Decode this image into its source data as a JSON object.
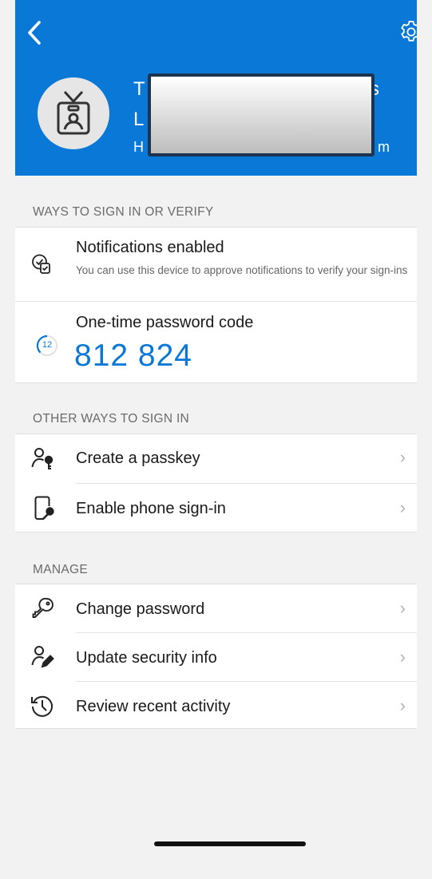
{
  "account": {
    "line1_start": "T",
    "line1_end": "s",
    "line2_start": "L",
    "line3_start": "H",
    "line3_end": "m"
  },
  "sections": {
    "ways": "WAYS TO SIGN IN OR VERIFY",
    "other": "OTHER WAYS TO SIGN IN",
    "manage": "MANAGE"
  },
  "notifications": {
    "title": "Notifications enabled",
    "subtitle": "You can use this device to approve notifications to verify your sign-ins"
  },
  "otp": {
    "title": "One-time password code",
    "code": "812 824",
    "seconds_remaining": "12"
  },
  "other_items": [
    {
      "label": "Create a passkey"
    },
    {
      "label": "Enable phone sign-in"
    }
  ],
  "manage_items": [
    {
      "label": "Change password"
    },
    {
      "label": "Update security info"
    },
    {
      "label": "Review recent activity"
    }
  ],
  "chevron": "›",
  "colors": {
    "header_blue": "#0a78d7",
    "code_blue": "#0a78d7"
  }
}
